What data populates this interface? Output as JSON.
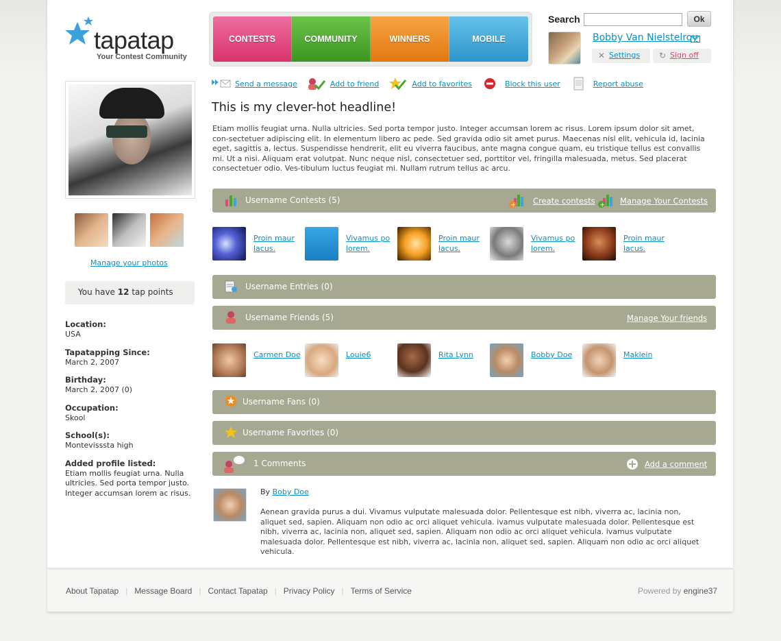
{
  "brand": {
    "name": "tapatap",
    "tagline": "Your Contest Community"
  },
  "nav": [
    {
      "label": "CONTESTS",
      "color": "#e24a7f"
    },
    {
      "label": "COMMUNITY",
      "color": "#4ca52d"
    },
    {
      "label": "WINNERS",
      "color": "#f08a1c"
    },
    {
      "label": "MOBILE",
      "color": "#3aa5d9"
    }
  ],
  "search": {
    "label": "Search",
    "button": "Ok",
    "value": ""
  },
  "user": {
    "name": "Bobby Van Nielstelroy",
    "settings": "Settings",
    "signoff": "Sign off"
  },
  "actions": [
    {
      "label": "Send a message",
      "icon": "mail-icon"
    },
    {
      "label": "Add to friend",
      "icon": "add-friend-icon"
    },
    {
      "label": "Add to favorites",
      "icon": "favorite-check-icon"
    },
    {
      "label": "Block this user",
      "icon": "block-icon"
    },
    {
      "label": "Report abuse",
      "icon": "report-icon"
    }
  ],
  "profile": {
    "headline": "This is my clever-hot headline!",
    "body": "Etiam mollis feugiat urna. Nulla ultricies. Sed porta tempor justo. Integer accumsan lorem ac risus. Lorem ipsum dolor sit amet, con-sectetuer adipiscing elit. In elementum libero ac pede. Sed gravida odio sit amet purus. Maecenas nisl elit, vehicula id, lacinia eget, sagittis a, lectus. Suspendisse hendrerit, elit eu viverra faucibus, ante magna congue quam, eu tristique tellus est convallis mi. Ut a nisi. Aliquam erat volutpat. Nunc neque nisl, consectetuer sed, porttitor vel, fringilla malesuada, metus. Sed placerat consectetuer odio. Ves-tibulum luctus feugiat mi. Nullam rutrum tellus ac arcu.",
    "manage_photos": "Manage your photos",
    "tap_points": {
      "prefix": "You have",
      "count": "12",
      "suffix": "tap points"
    },
    "info": [
      {
        "label": "Location:",
        "value": "USA"
      },
      {
        "label": "Tapatapping Since:",
        "value": "March 2, 2007"
      },
      {
        "label": "Birthday:",
        "value": "March 2, 2007 (0)"
      },
      {
        "label": "Occupation:",
        "value": "Skool"
      },
      {
        "label": "School(s):",
        "value": "Montevisssta high"
      },
      {
        "label": "Added profile listed:",
        "value": "Etiam mollis feugiat urna. Nulla ultricies. Sed porta tempor justo. Integer accumsan lorem ac risus."
      }
    ]
  },
  "sections": {
    "contests": {
      "title": "Username Contests (5)",
      "create": "Create contests",
      "manage": "Manage Your Contests"
    },
    "entries": {
      "title": "Username Entries (0)"
    },
    "friends": {
      "title": "Username Friends (5)",
      "manage": "Manage Your friends"
    },
    "fans": {
      "title": "Username Fans (0)"
    },
    "favorites": {
      "title": "Username Favorites (0)"
    },
    "comments": {
      "title": "1 Comments",
      "add": "Add a comment"
    }
  },
  "contests": [
    {
      "label": "Proin maur lacus."
    },
    {
      "label": "Vivamus po lorem."
    },
    {
      "label": "Proin maur lacus."
    },
    {
      "label": "Vivamus po lorem."
    },
    {
      "label": "Proin maur lacus."
    }
  ],
  "friends": [
    {
      "label": "Carmen Doe"
    },
    {
      "label": "Louie6"
    },
    {
      "label": "Rita Lynn"
    },
    {
      "label": "Bobby Doe"
    },
    {
      "label": "Maklein"
    }
  ],
  "comment": {
    "by_prefix": "By",
    "author": "Boby Doe",
    "text": "Aenean gravida purus a dui. Vivamus vulputate malesuada dolor. Pellentesque est nibh, viverra ac, lacinia non, aliquet sed, sapien. Aliquam non odio ac orci aliquet vehicula. ivamus vulputate malesuada dolor. Pellentesque est nibh, viverra ac, lacinia non, aliquet sed, sapien. Aliquam non odio ac orci aliquet vehicula. ivamus vulputate malesuada dolor. Pellentesque est nibh, viverra ac, lacinia non, aliquet sed, sapien. Aliquam non odio ac orci aliquet vehicula."
  },
  "footer": {
    "links": [
      "About Tapatap",
      "Message Board",
      "Contact Tapatap",
      "Privacy Policy",
      "Terms of Service"
    ],
    "powered_prefix": "Powered by",
    "powered_brand": "engine37"
  }
}
